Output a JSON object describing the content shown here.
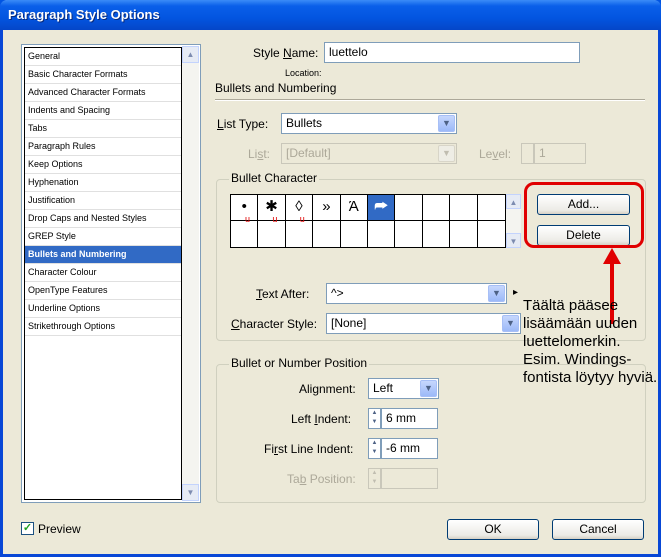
{
  "window": {
    "title": "Paragraph Style Options"
  },
  "sidebar": {
    "items": [
      {
        "label": "General"
      },
      {
        "label": "Basic Character Formats"
      },
      {
        "label": "Advanced Character Formats"
      },
      {
        "label": "Indents and Spacing"
      },
      {
        "label": "Tabs"
      },
      {
        "label": "Paragraph Rules"
      },
      {
        "label": "Keep Options"
      },
      {
        "label": "Hyphenation"
      },
      {
        "label": "Justification"
      },
      {
        "label": "Drop Caps and Nested Styles"
      },
      {
        "label": "GREP Style"
      },
      {
        "label": "Bullets and Numbering",
        "selected": true
      },
      {
        "label": "Character Colour"
      },
      {
        "label": "OpenType Features"
      },
      {
        "label": "Underline Options"
      },
      {
        "label": "Strikethrough Options"
      }
    ]
  },
  "style_name": {
    "label_pre": "Style ",
    "label_u": "N",
    "label_post": "ame:",
    "value": "luettelo"
  },
  "location": {
    "label": "Location:"
  },
  "section_title": "Bullets and Numbering",
  "list_type": {
    "label_u": "L",
    "label_post": "ist Type:",
    "value": "Bullets"
  },
  "list": {
    "label_pre": "Li",
    "label_u": "s",
    "label_post": "t:",
    "value": "[Default]"
  },
  "level": {
    "label_pre": "Le",
    "label_u": "v",
    "label_post": "el:",
    "value": "1"
  },
  "bullet_character": {
    "group_label": "Bullet Character",
    "cells": [
      "•",
      "✱",
      "◊",
      "»",
      "Ά",
      "⮫",
      "",
      "",
      "",
      "",
      "",
      "",
      "",
      "",
      "",
      "",
      "",
      "",
      "",
      ""
    ],
    "underline_marks": [
      "u",
      "u",
      "u"
    ],
    "add_label": "Add...",
    "delete_label": "Delete"
  },
  "text_after": {
    "label_u": "T",
    "label_post": "ext After:",
    "value": "^>",
    "flyout": "▸"
  },
  "character_style": {
    "label_u": "C",
    "label_post": "haracter Style:",
    "value": "[None]"
  },
  "position": {
    "group_label": "Bullet or Number Position",
    "alignment": {
      "label": "Alignment:",
      "value": "Left"
    },
    "left_indent": {
      "label_pre": "Left ",
      "label_u": "I",
      "label_post": "ndent:",
      "value": "6 mm"
    },
    "first_line_indent": {
      "label_pre": "Fi",
      "label_u": "r",
      "label_post": "st Line Indent:",
      "value": "-6 mm"
    },
    "tab_position": {
      "label_pre": "Ta",
      "label_u": "b",
      "label_post": " Position:",
      "value": ""
    }
  },
  "annotation": {
    "text": "Täältä pääsee lisäämään uuden luettelomerkin. Esim. Windings-fontista löytyy hyviä."
  },
  "footer": {
    "preview_label": "Preview",
    "preview_checked": true,
    "ok_label": "OK",
    "cancel_label": "Cancel"
  },
  "colors": {
    "accent": "#316ac5",
    "annotation": "#e00000",
    "titlebar": "#0355e0"
  }
}
